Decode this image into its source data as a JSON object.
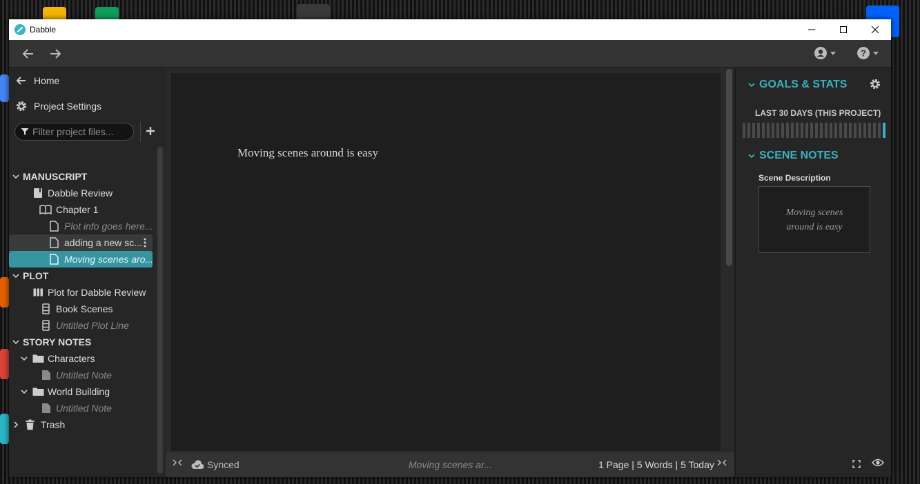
{
  "window": {
    "title": "Dabble"
  },
  "sidebar": {
    "home_label": "Home",
    "project_settings_label": "Project Settings",
    "filter_placeholder": "Filter project files...",
    "manuscript": {
      "heading": "MANUSCRIPT",
      "book": "Dabble Review",
      "chapter": "Chapter 1",
      "scenes": [
        "Plot info goes here...",
        "adding a new sc...",
        "Moving scenes aro..."
      ]
    },
    "plot": {
      "heading": "PLOT",
      "grid": "Plot for Dabble Review",
      "lines": [
        "Book Scenes",
        "Untitled Plot Line"
      ]
    },
    "story_notes": {
      "heading": "STORY NOTES",
      "folders": [
        {
          "label": "Characters",
          "note": "Untitled Note"
        },
        {
          "label": "World Building",
          "note": "Untitled Note"
        }
      ]
    },
    "trash_label": "Trash"
  },
  "editor": {
    "content": "Moving scenes around is easy"
  },
  "statusbar": {
    "sync_label": "Synced",
    "current_scene": "Moving scenes ar...",
    "stats": "1 Page | 5 Words | 5 Today"
  },
  "rightpanel": {
    "goals_heading": "GOALS & STATS",
    "last30_label": "LAST 30 DAYS (THIS PROJECT)",
    "scene_notes_heading": "SCENE NOTES",
    "scene_description_label": "Scene Description",
    "scene_description_text": "Moving scenes around is easy"
  },
  "colors": {
    "accent": "#3ab0bf",
    "selected_row": "#3596a2"
  }
}
